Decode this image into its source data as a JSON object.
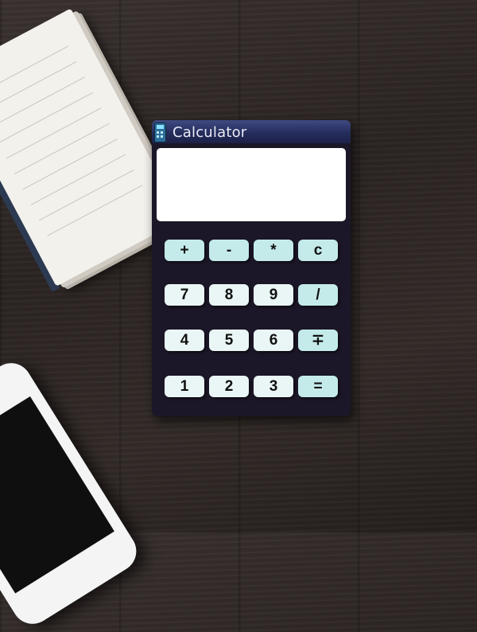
{
  "window": {
    "title": "Calculator",
    "icon": "calculator-app-icon"
  },
  "display": {
    "value": ""
  },
  "keypad": {
    "rows": [
      [
        {
          "label": "+",
          "kind": "operator"
        },
        {
          "label": "-",
          "kind": "operator"
        },
        {
          "label": "*",
          "kind": "operator"
        },
        {
          "label": "c",
          "kind": "operator"
        }
      ],
      [
        {
          "label": "7",
          "kind": "number"
        },
        {
          "label": "8",
          "kind": "number"
        },
        {
          "label": "9",
          "kind": "number"
        },
        {
          "label": "/",
          "kind": "operator"
        }
      ],
      [
        {
          "label": "4",
          "kind": "number"
        },
        {
          "label": "5",
          "kind": "number"
        },
        {
          "label": "6",
          "kind": "number"
        },
        {
          "label": "∓",
          "kind": "operator"
        }
      ],
      [
        {
          "label": "1",
          "kind": "number"
        },
        {
          "label": "2",
          "kind": "number"
        },
        {
          "label": "3",
          "kind": "number"
        },
        {
          "label": "=",
          "kind": "operator"
        }
      ]
    ]
  },
  "colors": {
    "body": "#1c1728",
    "titlebar": "#252d5c",
    "operator_key": "#c4ebea",
    "number_key": "#eaf6f5",
    "display": "#ffffff"
  }
}
